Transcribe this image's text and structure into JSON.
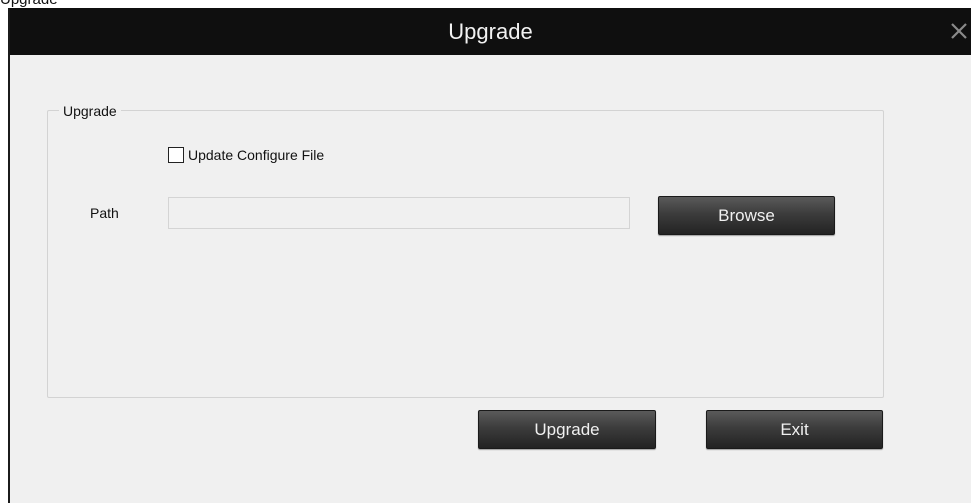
{
  "background_text": "Upgrade",
  "window": {
    "title": "Upgrade",
    "close_icon": "close-icon"
  },
  "group": {
    "legend": "Upgrade",
    "checkbox": {
      "label": "Update Configure File",
      "checked": false
    },
    "path": {
      "label": "Path",
      "value": "",
      "placeholder": ""
    },
    "browse_label": "Browse"
  },
  "footer": {
    "upgrade_label": "Upgrade",
    "exit_label": "Exit"
  },
  "colors": {
    "titlebar": "#0f0f0f",
    "dialog_bg": "#f0f0f0",
    "button_dark": "#3c3c3c",
    "button_text": "#f0f0f0"
  }
}
